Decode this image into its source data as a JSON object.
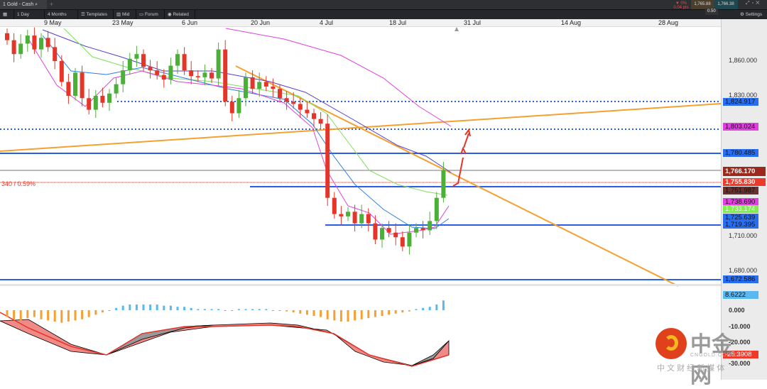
{
  "tab": {
    "index": "1",
    "title": "Gold - Cash"
  },
  "toolbar": {
    "interval": "1 Day",
    "range": "4 Months",
    "templates": "Templates",
    "mid": "Mid",
    "forum": "Forum",
    "related": "Related",
    "settings": "Settings"
  },
  "quote": {
    "change_pct": "▼ 0%",
    "change_pts": "0.04 pts",
    "sell": "1,765.88",
    "buy": "1,766.38",
    "spread": "0.50"
  },
  "dates": [
    "9 May",
    "23 May",
    "6 Jun",
    "20 Jun",
    "4 Jul",
    "18 Jul",
    "31 Jul",
    "14 Aug",
    "28 Aug"
  ],
  "price_axis": [
    "1,860.000",
    "1,830.000",
    "1,710.000",
    "1,680.000"
  ],
  "tags": {
    "t1": "1,824.917",
    "t2": "1,803.024",
    "t3": "1,780.485",
    "t4": "1,766.170",
    "t5": "1,755.830",
    "t6": "1,751.987",
    "t7": "1,738.690",
    "t8": "1,733.174",
    "t9": "1,725.639",
    "t10": "1,719.395",
    "t11": "1,672.586"
  },
  "change_label": "340 / 0.59%",
  "macd_axis": [
    "0.000",
    "-10.000",
    "-20.000",
    "-30.000"
  ],
  "macd_tags": {
    "hist": "8.6222",
    "line": "-25.3908"
  },
  "watermark": {
    "name": "中金网",
    "domain": "CNGOLD.COM.CN",
    "slogan": "中 文 财 经 新 媒 体"
  },
  "colors": {
    "up": "#4caf38",
    "down": "#e53528",
    "level": "#2a5ee8",
    "trend": "#f5a030"
  },
  "closes": [
    1878,
    1866,
    1875,
    1882,
    1870,
    1880,
    1872,
    1860,
    1842,
    1830,
    1850,
    1828,
    1818,
    1830,
    1824,
    1832,
    1840,
    1852,
    1862,
    1866,
    1855,
    1852,
    1848,
    1844,
    1856,
    1866,
    1852,
    1847,
    1846,
    1850,
    1845,
    1870,
    1825,
    1815,
    1828,
    1846,
    1836,
    1842,
    1838,
    1836,
    1828,
    1825,
    1823,
    1818,
    1815,
    1810,
    1806,
    1742,
    1728,
    1726,
    1730,
    1720,
    1728,
    1720,
    1706,
    1716,
    1712,
    1708,
    1700,
    1712,
    1716,
    1714,
    1722,
    1742,
    1766
  ],
  "macd_hist": [
    -6,
    -8,
    -9,
    -7,
    -6,
    -8,
    -9,
    -10,
    -11,
    -10,
    -9,
    -8,
    -6,
    -4,
    -2,
    0,
    2,
    4,
    5,
    5,
    5,
    5,
    5,
    4,
    4,
    3,
    3,
    2,
    1,
    1,
    1,
    1,
    0,
    0,
    1,
    1,
    1,
    1,
    1,
    0,
    0,
    -1,
    -2,
    -3,
    -4,
    -5,
    -6,
    -8,
    -9,
    -10,
    -10,
    -9,
    -8,
    -7,
    -6,
    -5,
    -4,
    -3,
    -2,
    -1,
    1,
    2,
    3,
    5,
    8.6
  ]
}
